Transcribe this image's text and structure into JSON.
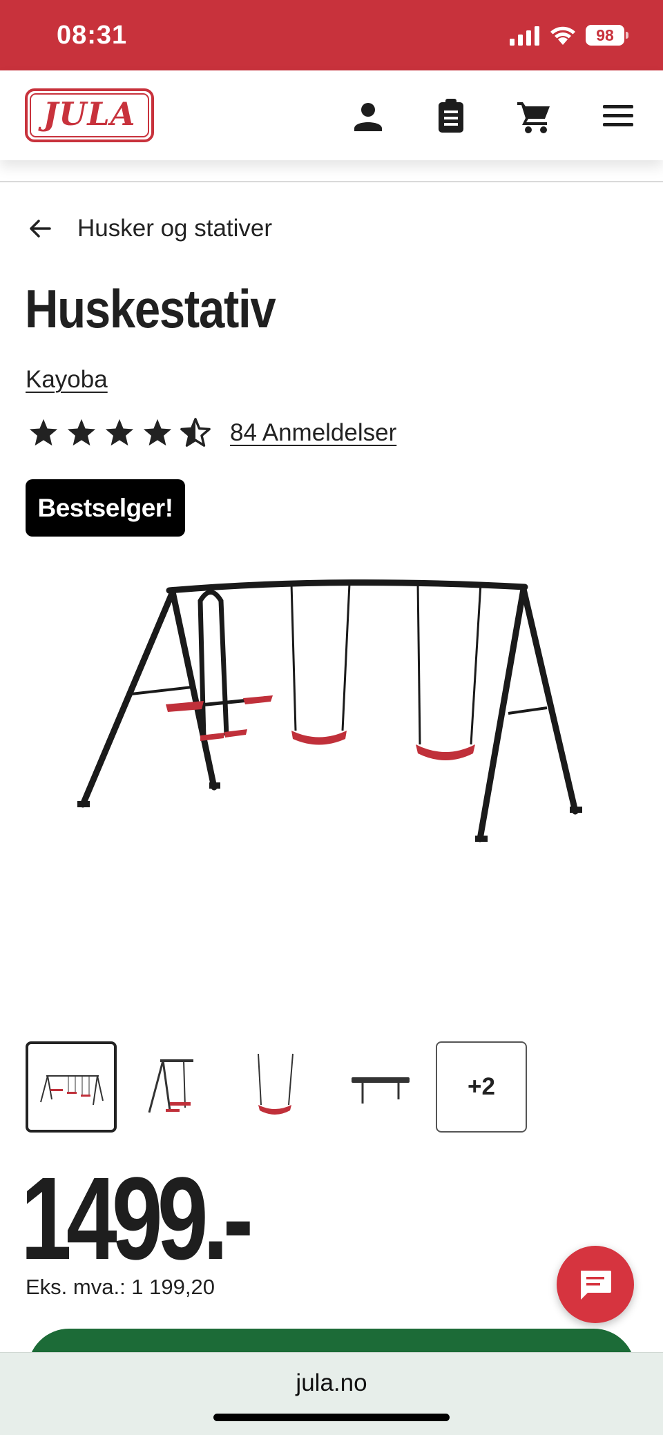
{
  "status_bar": {
    "time": "08:31",
    "battery": "98"
  },
  "header": {
    "logo_text": "JULA"
  },
  "breadcrumb": {
    "label": "Husker og stativer"
  },
  "product": {
    "title": "Huskestativ",
    "brand": "Kayoba",
    "rating": 4.5,
    "rating_max": 5,
    "reviews_label": "84 Anmeldelser",
    "badge": "Bestselger!",
    "price": "1499.-",
    "ex_vat": "Eks. mva.: 1 199,20"
  },
  "gallery": {
    "more_label": "+2",
    "active_index": 0
  },
  "browser": {
    "url": "jula.no"
  },
  "colors": {
    "brand_red": "#c8323c",
    "swing_red": "#c0303a",
    "buy_green": "#1c6b37"
  }
}
